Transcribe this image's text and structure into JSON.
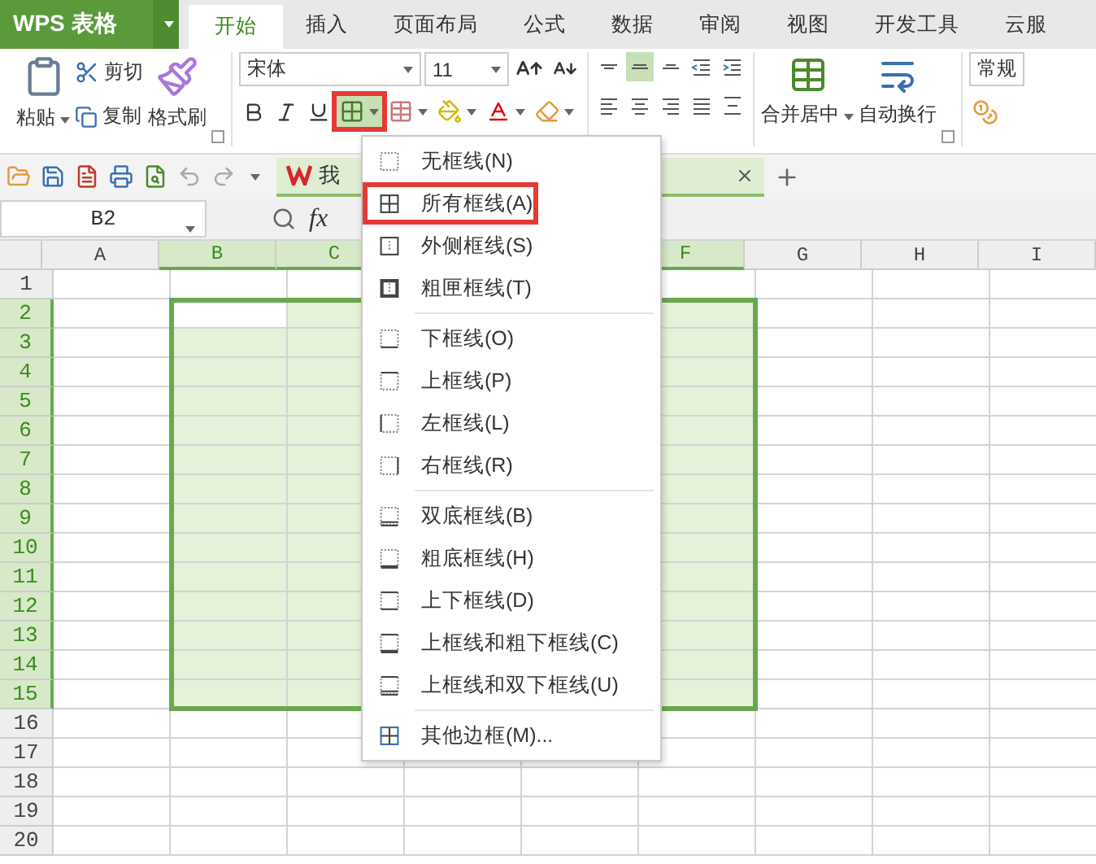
{
  "app_button": {
    "label": "WPS 表格"
  },
  "tabs": [
    {
      "label": "开始",
      "selected": true
    },
    {
      "label": "插入",
      "selected": false
    },
    {
      "label": "页面布局",
      "selected": false
    },
    {
      "label": "公式",
      "selected": false
    },
    {
      "label": "数据",
      "selected": false
    },
    {
      "label": "审阅",
      "selected": false
    },
    {
      "label": "视图",
      "selected": false
    },
    {
      "label": "开发工具",
      "selected": false
    },
    {
      "label": "云服",
      "selected": false
    }
  ],
  "clipboard": {
    "paste": "粘贴",
    "cut": "剪切",
    "copy": "复制",
    "format_painter": "格式刷"
  },
  "font": {
    "name": "宋体",
    "size": "11",
    "border_button_highlighted": true
  },
  "alignment": [
    [
      {
        "kind": "top",
        "selected": false
      },
      {
        "kind": "middle",
        "selected": true
      },
      {
        "kind": "bottom",
        "selected": false
      },
      {
        "kind": "outdent",
        "selected": false
      },
      {
        "kind": "indent",
        "selected": false
      }
    ],
    [
      {
        "kind": "left",
        "selected": false
      },
      {
        "kind": "center",
        "selected": false
      },
      {
        "kind": "right",
        "selected": false
      },
      {
        "kind": "justify",
        "selected": false
      },
      {
        "kind": "distributed",
        "selected": false
      }
    ]
  ],
  "merge": {
    "merge_center": "合并居中",
    "wrap_text": "自动换行"
  },
  "number_format": {
    "value": "常规"
  },
  "doc_tab": {
    "title": "我"
  },
  "formula_bar": {
    "name_box": "B2",
    "function_label": "fx"
  },
  "sheet": {
    "columns": [
      {
        "label": "A",
        "selected": false
      },
      {
        "label": "B",
        "selected": true
      },
      {
        "label": "C",
        "selected": true
      },
      {
        "selected": true
      },
      {
        "selected": true
      },
      {
        "label": "F",
        "selected": true
      },
      {
        "label": "G",
        "selected": false
      },
      {
        "label": "H",
        "selected": false
      },
      {
        "label": "I",
        "selected": false
      }
    ],
    "rows": [
      {
        "label": "1",
        "selected": false
      },
      {
        "label": "2",
        "selected": true
      },
      {
        "label": "3",
        "selected": true
      },
      {
        "label": "4",
        "selected": true
      },
      {
        "label": "5",
        "selected": true
      },
      {
        "label": "6",
        "selected": true
      },
      {
        "label": "7",
        "selected": true
      },
      {
        "label": "8",
        "selected": true
      },
      {
        "label": "9",
        "selected": true
      },
      {
        "label": "10",
        "selected": true
      },
      {
        "label": "11",
        "selected": true
      },
      {
        "label": "12",
        "selected": true
      },
      {
        "label": "13",
        "selected": true
      },
      {
        "label": "14",
        "selected": true
      },
      {
        "label": "15",
        "selected": true
      },
      {
        "label": "16",
        "selected": false
      },
      {
        "label": "17",
        "selected": false
      },
      {
        "label": "18",
        "selected": false
      },
      {
        "label": "19",
        "selected": false
      },
      {
        "label": "20",
        "selected": false
      }
    ]
  },
  "border_menu": {
    "groups": [
      [
        {
          "kind": "none",
          "label": "无框线(N)",
          "highlighted": false
        },
        {
          "kind": "all",
          "label": "所有框线(A)",
          "highlighted": true
        },
        {
          "kind": "outside",
          "label": "外侧框线(S)",
          "highlighted": false
        },
        {
          "kind": "thick-box",
          "label": "粗匣框线(T)",
          "highlighted": false
        }
      ],
      [
        {
          "kind": "bottom",
          "label": "下框线(O)",
          "highlighted": false
        },
        {
          "kind": "top",
          "label": "上框线(P)",
          "highlighted": false
        },
        {
          "kind": "left",
          "label": "左框线(L)",
          "highlighted": false
        },
        {
          "kind": "right",
          "label": "右框线(R)",
          "highlighted": false
        }
      ],
      [
        {
          "kind": "double-bottom",
          "label": "双底框线(B)",
          "highlighted": false
        },
        {
          "kind": "thick-bottom",
          "label": "粗底框线(H)",
          "highlighted": false
        },
        {
          "kind": "top-bottom",
          "label": "上下框线(D)",
          "highlighted": false
        },
        {
          "kind": "top-thick-bottom",
          "label": "上框线和粗下框线(C)",
          "highlighted": false
        },
        {
          "kind": "top-double-bottom",
          "label": "上框线和双下框线(U)",
          "highlighted": false
        }
      ],
      [
        {
          "kind": "more",
          "label": "其他边框(M)...",
          "highlighted": false
        }
      ]
    ]
  }
}
